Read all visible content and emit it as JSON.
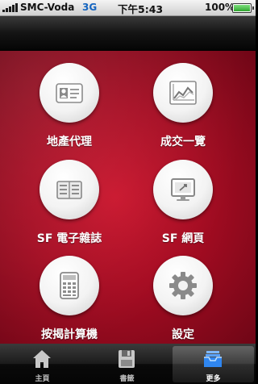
{
  "status_bar": {
    "carrier": "SMC-Voda",
    "network": "3G",
    "time": "下午5:43",
    "battery": "100%"
  },
  "grid": {
    "items": [
      {
        "label": "地產代理",
        "icon": "agent-card-icon"
      },
      {
        "label": "成交一覽",
        "icon": "chart-trend-icon"
      },
      {
        "label": "SF 電子雜誌",
        "icon": "magazine-icon"
      },
      {
        "label": "SF 網頁",
        "icon": "monitor-icon"
      },
      {
        "label": "按揭計算機",
        "icon": "calculator-icon"
      },
      {
        "label": "設定",
        "icon": "gear-icon"
      }
    ]
  },
  "tab_bar": {
    "tabs": [
      {
        "label": "主頁",
        "icon": "home-icon",
        "active": false
      },
      {
        "label": "書籤",
        "icon": "bookmark-icon",
        "active": false
      },
      {
        "label": "更多",
        "icon": "more-tray-icon",
        "active": true
      }
    ]
  },
  "colors": {
    "accent_red": "#b50f25",
    "tab_active_text": "#ffffff"
  }
}
